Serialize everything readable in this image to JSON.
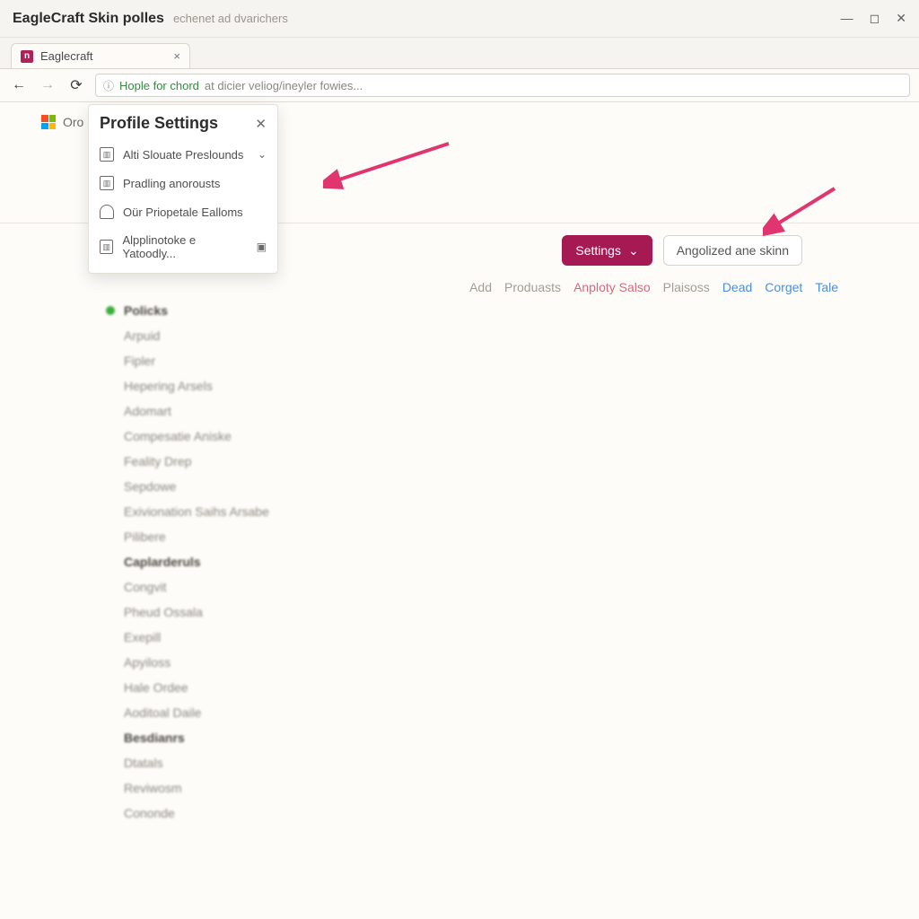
{
  "window": {
    "title_strong": "EagleCraft Skin polles",
    "title_sub": "echenet ad dvarichers"
  },
  "tab": {
    "label": "Eaglecraft"
  },
  "url": {
    "green": "Hople for chord",
    "rest": " at dicier veliog/ineyler fowies..."
  },
  "page_top_left": "Oro",
  "panel": {
    "title": "Profile Settings",
    "items": [
      {
        "label": "Alti Slouate Preslounds",
        "iconKind": "box",
        "trail": "chevron"
      },
      {
        "label": "Pradling anorousts",
        "iconKind": "box",
        "trail": ""
      },
      {
        "label": "Oür Priopetale Ealloms",
        "iconKind": "person",
        "trail": ""
      },
      {
        "label": "Alpplinotoke e Yatoodly...",
        "iconKind": "box",
        "trail": "square"
      }
    ]
  },
  "actions": {
    "settings": "Settings",
    "secondary": "Angolized ane skinn"
  },
  "subnav": [
    {
      "text": "Add",
      "cls": "sn-muted"
    },
    {
      "text": "Produasts",
      "cls": "sn-muted"
    },
    {
      "text": "Anploty Salso",
      "cls": "sn-pink"
    },
    {
      "text": "Plaisoss",
      "cls": "sn-muted"
    },
    {
      "text": "Dead",
      "cls": "sn-blue"
    },
    {
      "text": "Corget",
      "cls": "sn-blue"
    },
    {
      "text": "Tale",
      "cls": "sn-blue"
    }
  ],
  "sidelist": [
    {
      "text": "Policks",
      "dot": true,
      "head": false
    },
    {
      "text": "Arpuid"
    },
    {
      "text": "Fipler"
    },
    {
      "text": "Hepering Arsels"
    },
    {
      "text": "Adomart"
    },
    {
      "text": "Compesatie Aniske"
    },
    {
      "text": "Feality Drep"
    },
    {
      "text": "Sepdowe"
    },
    {
      "text": "Exivionation Saihs Arsabe"
    },
    {
      "text": "Pilibere"
    },
    {
      "text": "Caplarderuls",
      "head": true
    },
    {
      "text": "Congvit"
    },
    {
      "text": "Pheud Ossala"
    },
    {
      "text": "Exepill"
    },
    {
      "text": "Apyiloss"
    },
    {
      "text": "Hale Ordee"
    },
    {
      "text": "Aoditoal Daile"
    },
    {
      "text": "Besdianrs",
      "head": true
    },
    {
      "text": "Dtatals"
    },
    {
      "text": "Reviwosm"
    },
    {
      "text": "Cononde"
    }
  ],
  "colors": {
    "accent": "#a61a53",
    "arrow": "#e0356f"
  }
}
